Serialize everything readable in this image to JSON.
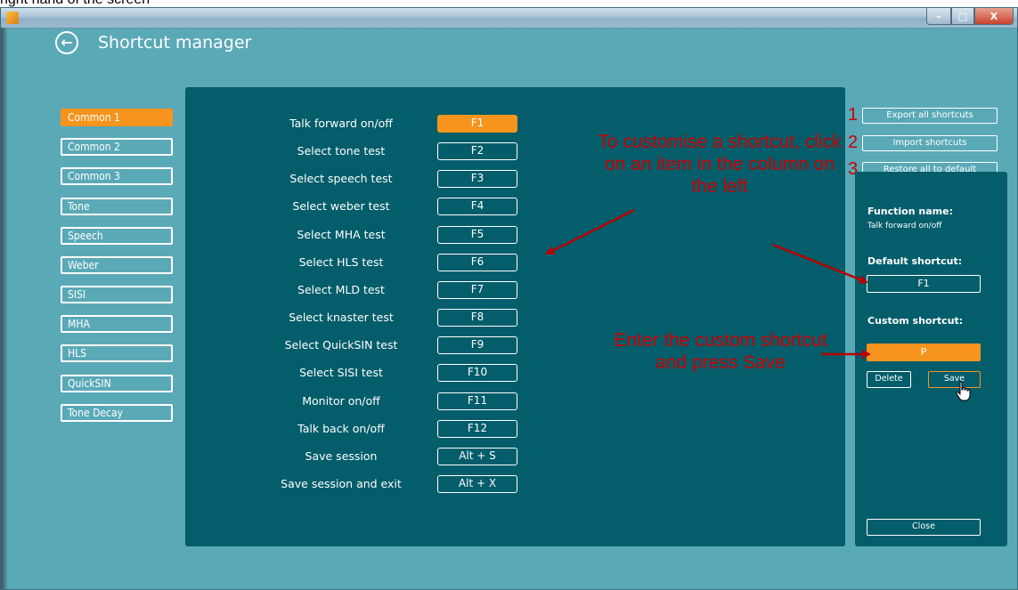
{
  "caption": "right hand of the screen",
  "window": {
    "controls": {
      "minimize": "–",
      "maximize": "□",
      "close": "X"
    }
  },
  "header": {
    "back_icon": "←",
    "title": "Shortcut manager"
  },
  "categories": [
    {
      "label": "Common 1",
      "active": true
    },
    {
      "label": "Common 2"
    },
    {
      "label": "Common 3"
    },
    {
      "label": "Tone"
    },
    {
      "label": "Speech"
    },
    {
      "label": "Weber"
    },
    {
      "label": "SISI"
    },
    {
      "label": "MHA"
    },
    {
      "label": "HLS"
    },
    {
      "label": "QuickSIN"
    },
    {
      "label": "Tone Decay"
    }
  ],
  "shortcuts": [
    {
      "function": "Talk forward on/off",
      "key": "F1",
      "selected": true
    },
    {
      "function": "Select tone test",
      "key": "F2"
    },
    {
      "function": "Select speech test",
      "key": "F3"
    },
    {
      "function": "Select weber test",
      "key": "F4"
    },
    {
      "function": "Select MHA test",
      "key": "F5"
    },
    {
      "function": "Select HLS test",
      "key": "F6"
    },
    {
      "function": "Select MLD test",
      "key": "F7"
    },
    {
      "function": "Select knaster test",
      "key": "F8"
    },
    {
      "function": "Select QuickSIN test",
      "key": "F9"
    },
    {
      "function": "Select SISI test",
      "key": "F10"
    },
    {
      "function": "Monitor on/off",
      "key": "F11"
    },
    {
      "function": "Talk back on/off",
      "key": "F12"
    },
    {
      "function": "Save session",
      "key": "Alt + S"
    },
    {
      "function": "Save session and exit",
      "key": "Alt + X"
    }
  ],
  "actions": {
    "export_label": "Export all shortcuts",
    "import_label": "Import shortcuts",
    "restore_label": "Restore all to default",
    "num1": "1",
    "num2": "2",
    "num3": "3"
  },
  "detail": {
    "function_name_heading": "Function name:",
    "function_name_value": "Talk forward on/off",
    "default_heading": "Default shortcut:",
    "default_value": "F1",
    "custom_heading": "Custom shortcut:",
    "custom_value": "P",
    "delete_label": "Delete",
    "save_label": "Save",
    "close_label": "Close"
  },
  "annotations": {
    "customise": "To customise a shortcut, click on an item in the column on the left",
    "enter": "Enter the custom shortcut and press Save"
  },
  "colors": {
    "accent": "#f7941d",
    "panel": "#035d6a",
    "annotation": "#cc0000"
  }
}
